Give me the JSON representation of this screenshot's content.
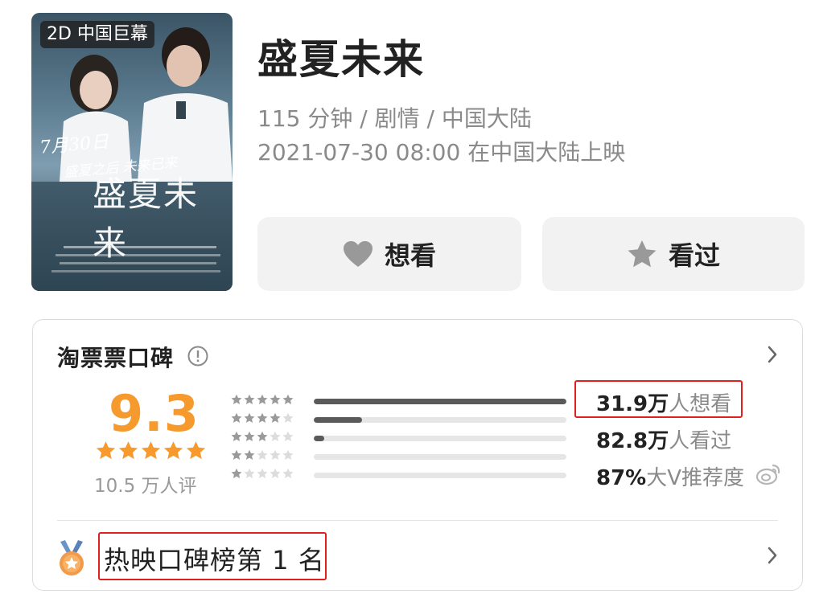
{
  "poster": {
    "badge": "2D 中国巨幕",
    "title_art": "盛夏未来",
    "date_art": "7月30日",
    "slogan_art": "盛夏之后 未来已来"
  },
  "movie": {
    "title": "盛夏未来",
    "meta_line": "115 分钟 / 剧情 / 中国大陆",
    "release_line": "2021-07-30 08:00 在中国大陆上映"
  },
  "actions": {
    "want_label": "想看",
    "seen_label": "看过",
    "want_icon": "heart-icon",
    "seen_icon": "star-icon"
  },
  "rating_card": {
    "title": "淘票票口碑",
    "score": "9.3",
    "score_stars": 5,
    "rating_count": "10.5 万人评",
    "distribution": [
      {
        "stars": 5,
        "fraction": 1.0
      },
      {
        "stars": 4,
        "fraction": 0.19
      },
      {
        "stars": 3,
        "fraction": 0.04
      },
      {
        "stars": 2,
        "fraction": 0.0
      },
      {
        "stars": 1,
        "fraction": 0.0
      }
    ],
    "stats": [
      {
        "num": "31.9万",
        "text": "人想看"
      },
      {
        "num": "82.8万",
        "text": "人看过"
      },
      {
        "num": "87%",
        "text": "大V推荐度"
      }
    ],
    "rank_label": "热映口碑榜第 1 名",
    "colors": {
      "score": "#f79a2e",
      "highlight": "#e0201f",
      "bar_fill": "#5a5a5a"
    }
  }
}
